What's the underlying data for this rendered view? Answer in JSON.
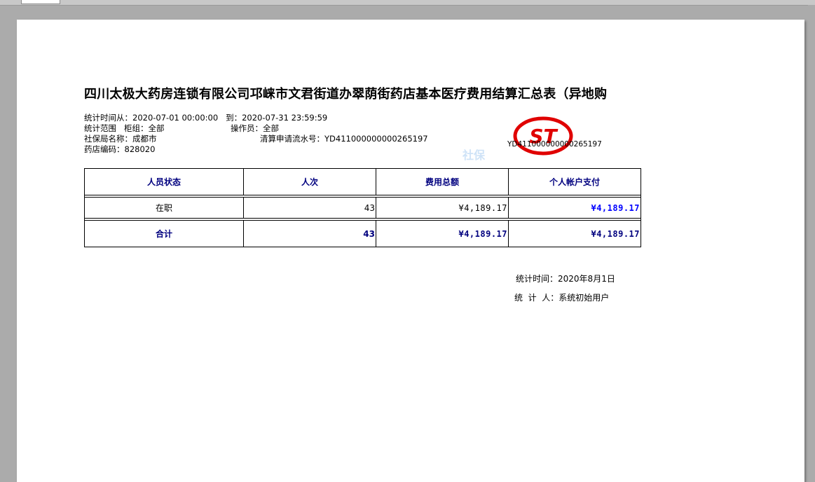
{
  "report": {
    "title": "四川太极大药房连锁有限公司邛崃市文君街道办翠荫街药店基本医疗费用结算汇总表（异地购",
    "period_label": "统计时间从：",
    "period_from": "2020-07-01 00:00:00",
    "period_to_label": "到：",
    "period_to": "2020-07-31 23:59:59",
    "scope_label": "统计范围",
    "counter_label": "柜组：",
    "counter_value": "全部",
    "operator_label": "操作员：",
    "operator_value": "全部",
    "bureau_label": "社保局名称：",
    "bureau_value": "成都市",
    "serial_label": "清算申请流水号：",
    "serial_value": "YD411000000000265197",
    "store_code_label": "药店编码：",
    "store_code_value": "828020",
    "stamp_serial": "YD411000000000265197",
    "stamp_text": "ST",
    "watermark": "社保"
  },
  "table": {
    "headers": [
      "人员状态",
      "人次",
      "费用总额",
      "个人帐户支付"
    ],
    "rows": [
      {
        "status": "在职",
        "count": "43",
        "total": "¥4,189.17",
        "personal": "¥4,189.17"
      }
    ],
    "total_row": {
      "status": "合计",
      "count": "43",
      "total": "¥4,189.17",
      "personal": "¥4,189.17"
    }
  },
  "footer": {
    "stat_time_label": "统计时间：",
    "stat_time_value": "2020年8月1日",
    "stat_person_label": "统  计  人：",
    "stat_person_value": "系统初始用户"
  },
  "colors": {
    "header_text": "#00007f",
    "amount_blue": "#0000ff",
    "stamp_red": "#e00000"
  }
}
